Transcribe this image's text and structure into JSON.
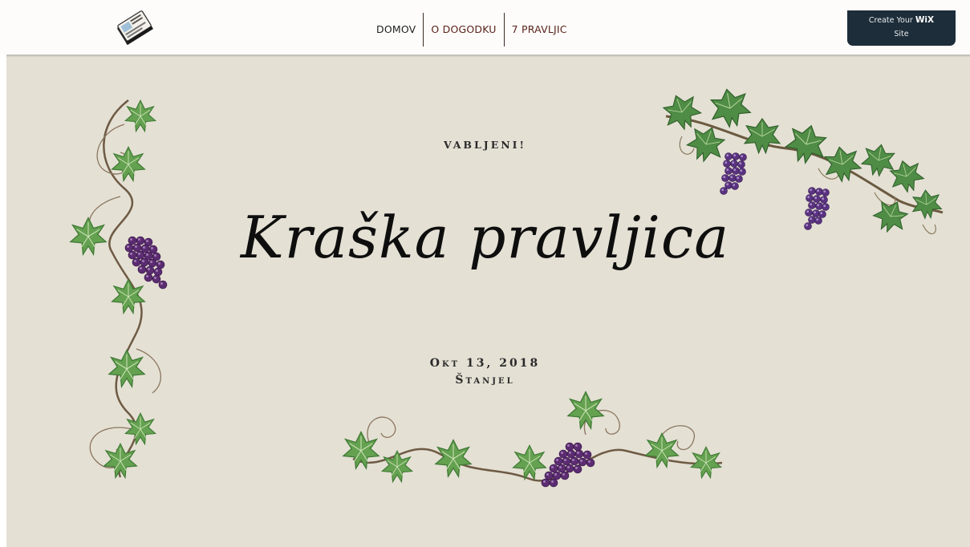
{
  "header": {
    "nav": [
      "DOMOV",
      "O DOGODKU",
      "7 PRAVLJIC"
    ],
    "wix_banner": {
      "line1_prefix": "Create Your",
      "brand": "WiX",
      "line2": "Site"
    }
  },
  "hero": {
    "kicker": "VABLJENI!",
    "title": "Kraška pravljica",
    "date": "Okt 13, 2018",
    "place": "Štanjel"
  },
  "icons": {
    "logo": "book-logo-icon",
    "vine_left": "grape-vine-left-icon",
    "vine_top_right": "grape-vine-top-right-icon",
    "vine_bottom": "grape-vine-bottom-icon"
  },
  "colors": {
    "background": "#e4e0d4",
    "header": "#fdfcfb",
    "nav_accent": "#5a2319",
    "wix_button": "#1d2d39",
    "leaf": "#5e9a4e",
    "grape": "#5a2a6e"
  }
}
